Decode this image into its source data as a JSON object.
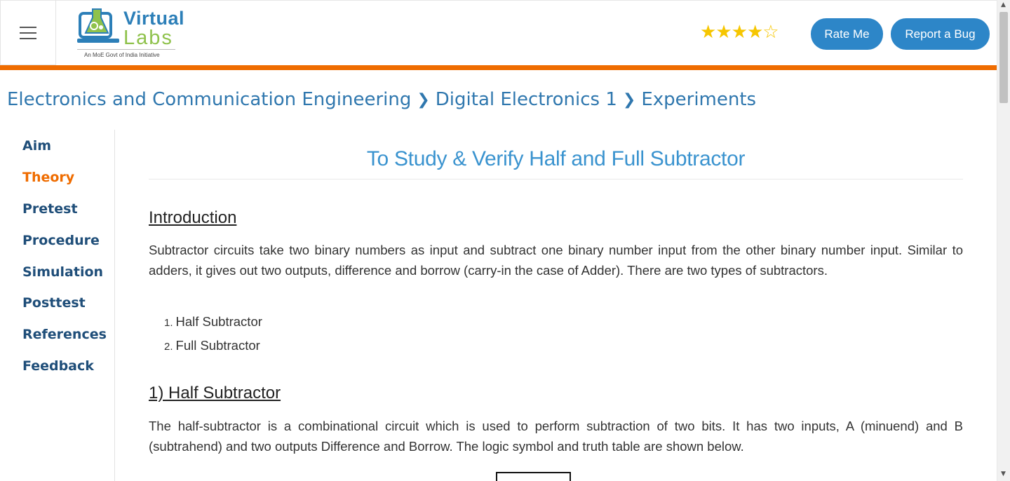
{
  "header": {
    "logo_virtual": "Virtual",
    "logo_labs": "Labs",
    "logo_tagline": "An MoE Govt of India Initiative",
    "rating": {
      "filled": 4,
      "total": 5
    },
    "rate_button": "Rate Me",
    "bug_button": "Report a Bug"
  },
  "breadcrumb": {
    "items": [
      "Electronics and Communication Engineering",
      "Digital Electronics 1",
      "Experiments"
    ]
  },
  "sidebar": {
    "items": [
      {
        "label": "Aim"
      },
      {
        "label": "Theory",
        "active": true
      },
      {
        "label": "Pretest"
      },
      {
        "label": "Procedure"
      },
      {
        "label": "Simulation"
      },
      {
        "label": "Posttest"
      },
      {
        "label": "References"
      },
      {
        "label": "Feedback"
      }
    ]
  },
  "content": {
    "title": "To Study & Verify Half and Full Subtractor",
    "intro_heading": "Introduction",
    "intro_text": "Subtractor circuits take two binary numbers as input and subtract one binary number input from the other binary number input. Similar to adders, it gives out two outputs, difference and borrow (carry-in the case of Adder). There are two types of subtractors.",
    "types": [
      "Half Subtractor",
      "Full Subtractor"
    ],
    "half_heading": "1) Half Subtractor",
    "half_text": "The half-subtractor is a combinational circuit which is used to perform subtraction of two bits. It has two inputs, A (minuend) and B (subtrahend) and two outputs Difference and Borrow. The logic symbol and truth table are shown below."
  },
  "colors": {
    "accent_orange": "#ef6c00",
    "link_blue": "#2f77ae",
    "button_blue": "#2d86c8",
    "title_blue": "#3a93cf",
    "star_yellow": "#f6c600"
  }
}
